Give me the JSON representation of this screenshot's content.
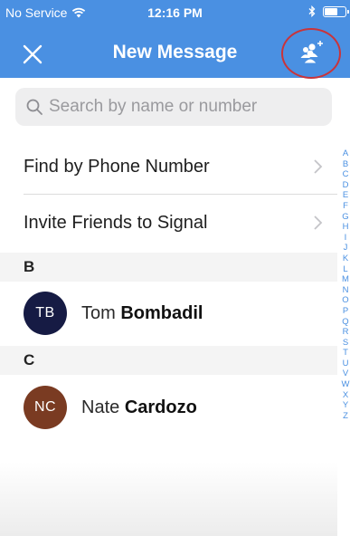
{
  "status_bar": {
    "carrier": "No Service",
    "time": "12:16 PM"
  },
  "nav": {
    "title": "New Message",
    "close_icon": "close-icon",
    "new_group_icon": "new-group-icon"
  },
  "colors": {
    "accent": "#4a90e2",
    "highlight_ring": "#c9343a",
    "avatar_tb": "#161b44",
    "avatar_nc": "#7a3b22"
  },
  "search": {
    "placeholder": "Search by name or number"
  },
  "actions": [
    {
      "label": "Find by Phone Number"
    },
    {
      "label": "Invite Friends to Signal"
    }
  ],
  "sections": [
    {
      "letter": "B",
      "contact": {
        "initials": "TB",
        "first": "Tom",
        "last": "Bombadil"
      }
    },
    {
      "letter": "C",
      "contact": {
        "initials": "NC",
        "first": "Nate",
        "last": "Cardozo"
      }
    }
  ],
  "index_letters": [
    "A",
    "B",
    "C",
    "D",
    "E",
    "F",
    "G",
    "H",
    "I",
    "J",
    "K",
    "L",
    "M",
    "N",
    "O",
    "P",
    "Q",
    "R",
    "S",
    "T",
    "U",
    "V",
    "W",
    "X",
    "Y",
    "Z"
  ]
}
